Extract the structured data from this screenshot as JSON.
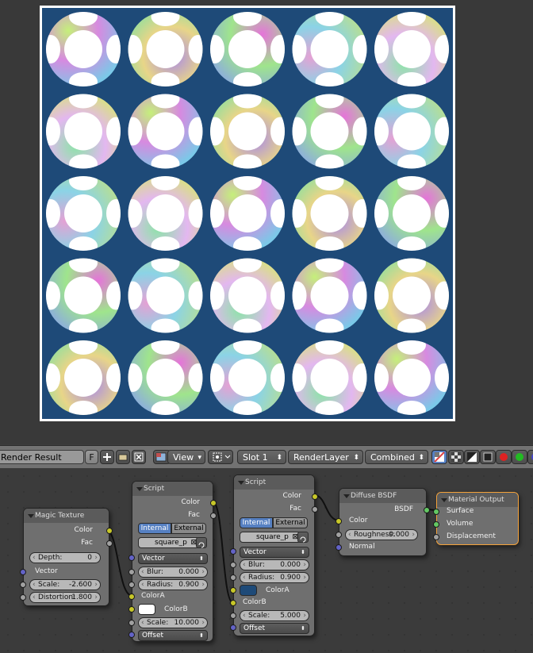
{
  "header": {
    "image_name": "Render Result",
    "fake_user_label": "F",
    "view_menu": "View",
    "slot_menu": "Slot 1",
    "layer_menu": "RenderLayer",
    "pass_menu": "Combined",
    "icons": [
      "image-browse-icon",
      "new-image-icon",
      "open-folder-icon",
      "unlink-icon",
      "pivot-icon",
      "rgb-alpha-icon",
      "checker-icon",
      "alpha-icon",
      "z-buffer-icon",
      "red-channel-icon",
      "green-channel-icon",
      "blue-channel-icon"
    ]
  },
  "colors": {
    "render_background": "#1e4a78",
    "frame_selected": "#f4a23a",
    "link": "#101010"
  },
  "nodes": {
    "magic": {
      "title": "Magic Texture",
      "out_color": "Color",
      "out_fac": "Fac",
      "depth_label": "Depth:",
      "depth_value": "0",
      "in_vector": "Vector",
      "scale_label": "Scale:",
      "scale_value": "-2.600",
      "distortion_label": "Distortion:",
      "distortion_value": "1.800"
    },
    "script1": {
      "title": "Script",
      "out_color": "Color",
      "out_fac": "Fac",
      "mode_internal": "Internal",
      "mode_external": "External",
      "script_name": "square_p",
      "vector_menu": "Vector",
      "blur_label": "Blur:",
      "blur_value": "0.000",
      "radius_label": "Radius:",
      "radius_value": "0.900",
      "colora_label": "ColorA",
      "colorb_label": "ColorB",
      "colorb_swatch": "#ffffff",
      "scale_label": "Scale:",
      "scale_value": "10.000",
      "offset_menu": "Offset"
    },
    "script2": {
      "title": "Script",
      "out_color": "Color",
      "out_fac": "Fac",
      "mode_internal": "Internal",
      "mode_external": "External",
      "script_name": "square_p",
      "vector_menu": "Vector",
      "blur_label": "Blur:",
      "blur_value": "0.000",
      "radius_label": "Radius:",
      "radius_value": "0.900",
      "colora_label": "ColorA",
      "colora_swatch": "#1e4a78",
      "colorb_label": "ColorB",
      "scale_label": "Scale:",
      "scale_value": "5.000",
      "offset_menu": "Offset"
    },
    "diffuse": {
      "title": "Diffuse BSDF",
      "out_bsdf": "BSDF",
      "in_color": "Color",
      "roughness_label": "Roughness:",
      "roughness_value": "0.000",
      "in_normal": "Normal"
    },
    "output": {
      "title": "Material Output",
      "in_surface": "Surface",
      "in_volume": "Volume",
      "in_displacement": "Displacement"
    }
  }
}
